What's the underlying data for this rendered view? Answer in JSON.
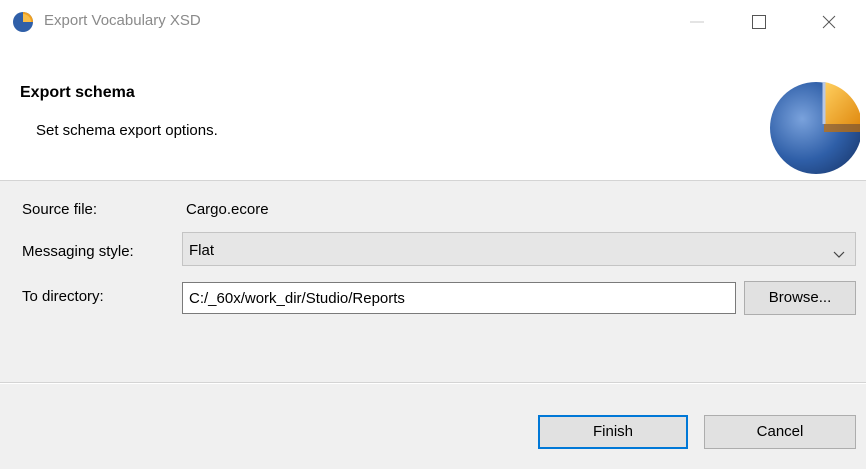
{
  "window": {
    "title": "Export Vocabulary XSD",
    "app_icon": "eclipse-pie-icon",
    "controls": [
      "minimize-icon",
      "maximize-icon",
      "close-icon"
    ]
  },
  "banner": {
    "heading": "Export schema",
    "description": "Set schema export options.",
    "graphic": "wizard-pie-graphic"
  },
  "form": {
    "source_label": "Source file:",
    "source_value": "Cargo.ecore",
    "style_label": "Messaging style:",
    "style_value": "Flat",
    "dir_label": "To directory:",
    "dir_value": "C:/_60x/work_dir/Studio/Reports",
    "browse_label": "Browse..."
  },
  "footer": {
    "finish_label": "Finish",
    "cancel_label": "Cancel"
  },
  "colors": {
    "accent": "#0078d7",
    "pie_blue": "#2f5fa8",
    "pie_orange": "#f0a020"
  }
}
